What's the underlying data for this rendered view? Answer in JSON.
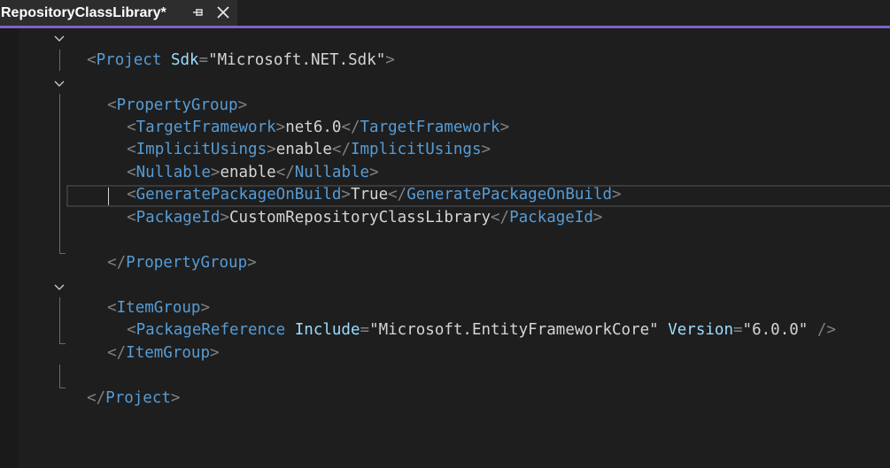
{
  "tab": {
    "title": "RepositoryClassLibrary*",
    "pin_icon": "pin-icon",
    "close_icon": "close-icon"
  },
  "colors": {
    "accent": "#7c63c9",
    "tag": "#569cd6",
    "attribute": "#9cdcfe",
    "text": "#d4d4d4",
    "punctuation": "#808080"
  },
  "code": {
    "project_open": {
      "lt": "<",
      "tag": "Project",
      "attr": "Sdk",
      "eq": "=",
      "value": "\"Microsoft.NET.Sdk\"",
      "gt": ">"
    },
    "propertygroup_open": {
      "lt": "<",
      "tag": "PropertyGroup",
      "gt": ">"
    },
    "target_framework": {
      "open_lt": "<",
      "tag": "TargetFramework",
      "open_gt": ">",
      "text": "net6.0",
      "close_lt": "</",
      "close_tag": "TargetFramework",
      "close_gt": ">"
    },
    "implicit_usings": {
      "open_lt": "<",
      "tag": "ImplicitUsings",
      "open_gt": ">",
      "text": "enable",
      "close_lt": "</",
      "close_tag": "ImplicitUsings",
      "close_gt": ">"
    },
    "nullable": {
      "open_lt": "<",
      "tag": "Nullable",
      "open_gt": ">",
      "text": "enable",
      "close_lt": "</",
      "close_tag": "Nullable",
      "close_gt": ">"
    },
    "generate_package": {
      "open_lt": "<",
      "tag": "GeneratePackageOnBuild",
      "open_gt": ">",
      "text": "True",
      "close_lt": "</",
      "close_tag": "GeneratePackageOnBuild",
      "close_gt": ">"
    },
    "package_id": {
      "open_lt": "<",
      "tag": "PackageId",
      "open_gt": ">",
      "text": "CustomRepositoryClassLibrary",
      "close_lt": "</",
      "close_tag": "PackageId",
      "close_gt": ">"
    },
    "propertygroup_close": {
      "lt": "</",
      "tag": "PropertyGroup",
      "gt": ">"
    },
    "itemgroup_open": {
      "lt": "<",
      "tag": "ItemGroup",
      "gt": ">"
    },
    "package_reference": {
      "lt": "<",
      "tag": "PackageReference",
      "attr1": "Include",
      "eq1": "=",
      "value1": "\"Microsoft.EntityFrameworkCore\"",
      "attr2": "Version",
      "eq2": "=",
      "value2": "\"6.0.0\"",
      "end": "/>"
    },
    "itemgroup_close": {
      "lt": "</",
      "tag": "ItemGroup",
      "gt": ">"
    },
    "project_close": {
      "lt": "</",
      "tag": "Project",
      "gt": ">"
    }
  }
}
